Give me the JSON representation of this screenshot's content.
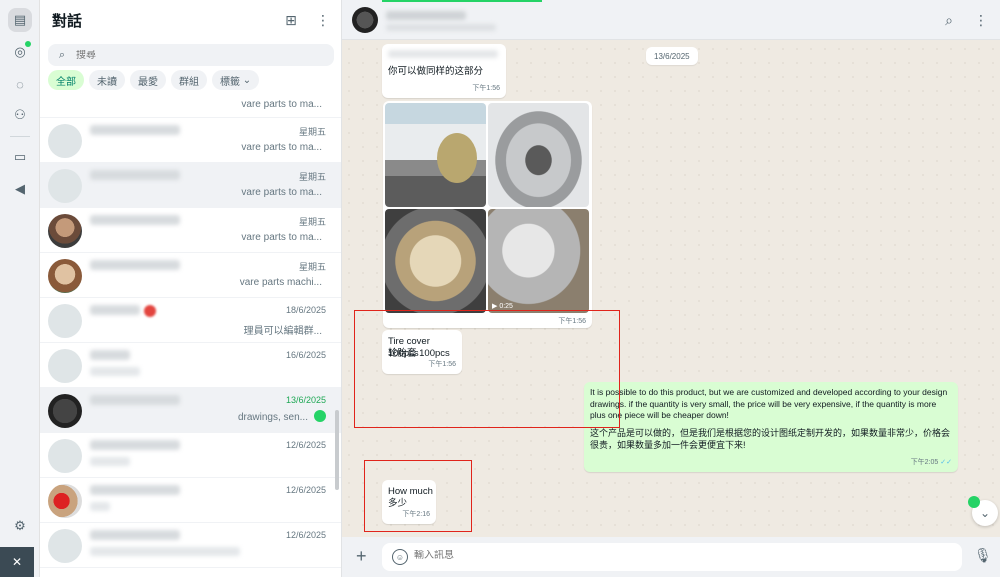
{
  "rail": {
    "bottom_label": "✕"
  },
  "list": {
    "title": "對話",
    "search_placeholder": "搜尋",
    "filters": [
      "全部",
      "未讀",
      "最愛",
      "群組",
      "標籤"
    ],
    "chats": [
      {
        "time": "",
        "preview": "vare parts to ma..."
      },
      {
        "time": "星期五",
        "preview": "vare parts to ma..."
      },
      {
        "time": "星期五",
        "preview": "vare parts to ma..."
      },
      {
        "time": "星期五",
        "preview": "vare parts to ma..."
      },
      {
        "time": "星期五",
        "preview": "vare parts machi..."
      },
      {
        "time": "18/6/2025",
        "preview": "理員可以編輯群..."
      },
      {
        "time": "16/6/2025",
        "preview": ""
      },
      {
        "time": "13/6/2025",
        "preview": "drawings, sen..."
      },
      {
        "time": "12/6/2025",
        "preview": ""
      },
      {
        "time": "12/6/2025",
        "preview": ""
      },
      {
        "time": "12/6/2025",
        "preview": ""
      }
    ]
  },
  "conversation": {
    "date_divider": "13/6/2025",
    "messages": {
      "m1": {
        "text": "你可以做同样的这部分",
        "time": "下午1:56"
      },
      "album": {
        "video_duration": "0:25",
        "time": "下午1:56"
      },
      "m2": {
        "line1": "Tire cover 100pcs",
        "line2": "轮胎套 100pcs",
        "time": "下午1:56"
      },
      "m3": {
        "en": "It is possible to do this product, but we are customized and developed according to your design drawings. if the quantity is very small, the price will be very expensive, if the quantity is more plus one piece will be cheaper down!",
        "zh": "这个产品是可以做的，但是我们是根据您的设计图纸定制开发的，如果数量非常少，价格会很贵，如果数量多加一件会更便宜下来!",
        "time": "下午2:05",
        "ticks": "✓✓"
      },
      "m4": {
        "line1": "How much",
        "line2": "多少",
        "time": "下午2:16"
      }
    },
    "composer_placeholder": "輸入訊息"
  },
  "colors": {
    "accent_green": "#25d366",
    "outgoing_bubble": "#d9fdd3",
    "highlight_red": "#e0241b"
  }
}
